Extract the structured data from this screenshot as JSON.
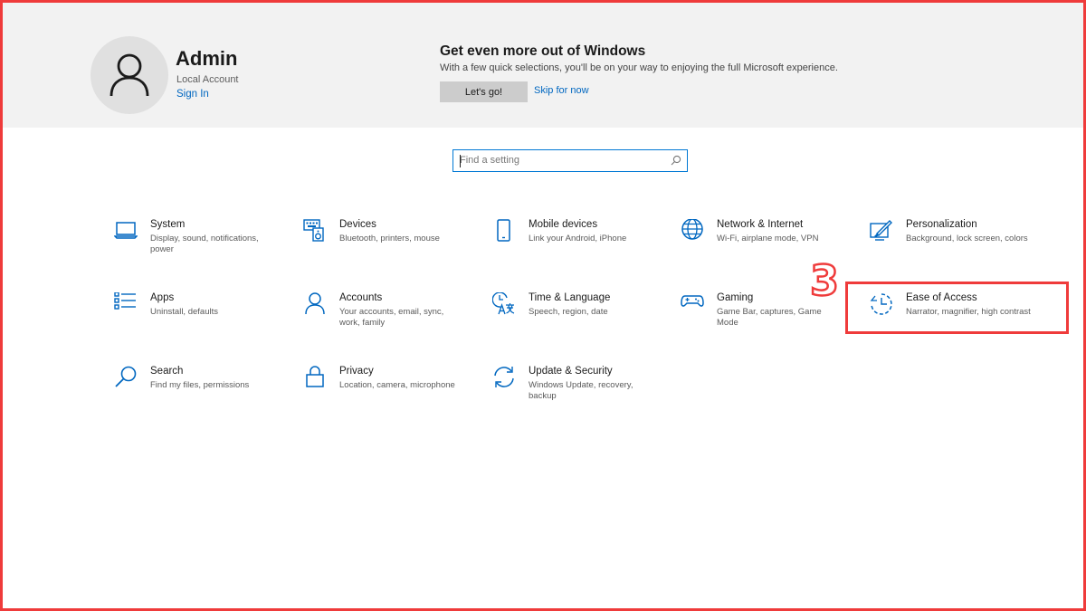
{
  "header": {
    "user_name": "Admin",
    "account_type": "Local Account",
    "sign_in": "Sign In",
    "promo_title": "Get even more out of Windows",
    "promo_desc": "With a few quick selections, you'll be on your way to enjoying the full Microsoft experience.",
    "promo_button": "Let's go!",
    "skip_link": "Skip for now"
  },
  "search": {
    "placeholder": "Find a setting"
  },
  "tiles": [
    {
      "title": "System",
      "desc": "Display, sound, notifications, power",
      "icon": "laptop-icon"
    },
    {
      "title": "Devices",
      "desc": "Bluetooth, printers, mouse",
      "icon": "keyboard-speaker-icon"
    },
    {
      "title": "Mobile devices",
      "desc": "Link your Android, iPhone",
      "icon": "phone-icon"
    },
    {
      "title": "Network & Internet",
      "desc": "Wi-Fi, airplane mode, VPN",
      "icon": "globe-icon"
    },
    {
      "title": "Personalization",
      "desc": "Background, lock screen, colors",
      "icon": "paint-icon"
    },
    {
      "title": "Apps",
      "desc": "Uninstall, defaults",
      "icon": "apps-list-icon"
    },
    {
      "title": "Accounts",
      "desc": "Your accounts, email, sync, work, family",
      "icon": "person-icon"
    },
    {
      "title": "Time & Language",
      "desc": "Speech, region, date",
      "icon": "time-language-icon"
    },
    {
      "title": "Gaming",
      "desc": "Game Bar, captures, Game Mode",
      "icon": "gamepad-icon"
    },
    {
      "title": "Ease of Access",
      "desc": "Narrator, magnifier, high contrast",
      "icon": "ease-of-access-icon"
    },
    {
      "title": "Search",
      "desc": "Find my files, permissions",
      "icon": "search-icon"
    },
    {
      "title": "Privacy",
      "desc": "Location, camera, microphone",
      "icon": "lock-icon"
    },
    {
      "title": "Update & Security",
      "desc": "Windows Update, recovery, backup",
      "icon": "sync-icon"
    }
  ],
  "annotation": {
    "step_number": "3"
  },
  "colors": {
    "accent": "#0067c0",
    "highlight": "#ef3b3b",
    "header_bg": "#f2f2f2"
  }
}
